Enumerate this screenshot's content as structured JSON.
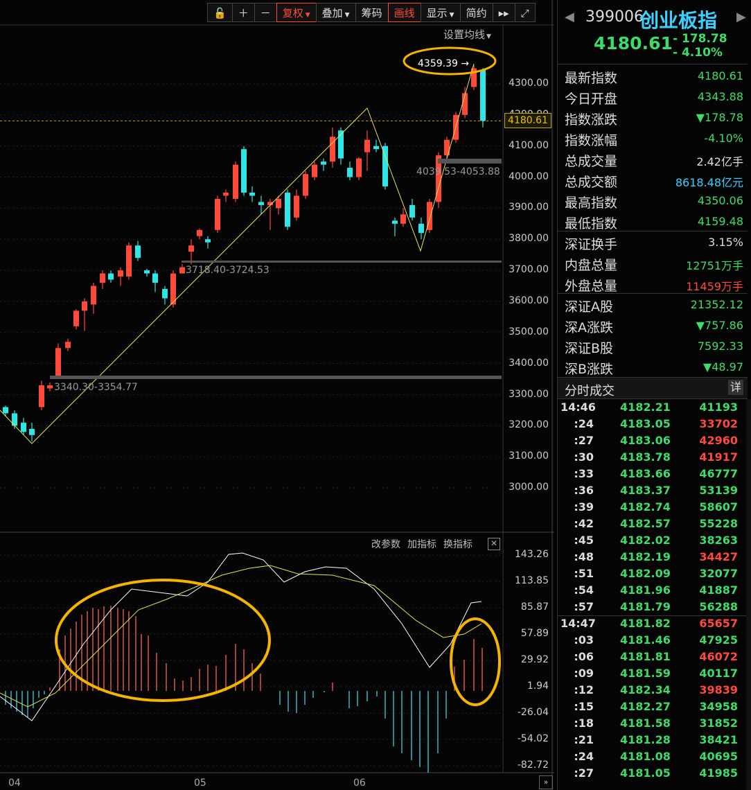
{
  "toolbar": {
    "items": [
      {
        "label": "复权",
        "dropdown": true,
        "color": "red",
        "active": true
      },
      {
        "label": "叠加",
        "dropdown": true
      },
      {
        "label": "筹码",
        "dropdown": false
      },
      {
        "label": "画线",
        "dropdown": false,
        "color": "red",
        "active": true
      },
      {
        "label": "显示",
        "dropdown": true
      },
      {
        "label": "简约",
        "dropdown": false
      }
    ],
    "icons": [
      "lock-icon",
      "plus-icon",
      "minus-icon",
      "double-right-icon",
      "fullscreen-icon"
    ]
  },
  "ma_setting_label": "设置均线",
  "price_axis": [
    "4300.00",
    "4200.00",
    "4100.00",
    "4000.00",
    "3900.00",
    "3800.00",
    "3700.00",
    "3600.00",
    "3500.00",
    "3400.00",
    "3300.00",
    "3200.00",
    "3100.00",
    "3000.00"
  ],
  "current_price_label": "4180.61",
  "annotations": {
    "high": "4359.39",
    "zone1": "3340.30-3354.77",
    "zone2": "3718.40-3724.53",
    "zone3": "4039.53-4053.88"
  },
  "indicator_toolbar": [
    "改参数",
    "加指标",
    "换指标"
  ],
  "indicator_axis": [
    "143.26",
    "113.85",
    "85.87",
    "57.89",
    "29.92",
    "1.94",
    "-26.04",
    "-54.02",
    "-82.72"
  ],
  "x_axis": [
    "04",
    "05",
    "06"
  ],
  "colors": {
    "up": "#ff4a3a",
    "down": "#2ee6e6",
    "highlight": "#f5b400",
    "bg": "#050505"
  },
  "quote": {
    "code": "399006",
    "name": "创业板指",
    "price": "4180.61",
    "change": "- 178.78",
    "change_pct": "- 4.10%"
  },
  "stats": [
    {
      "label": "最新指数",
      "value": "4180.61",
      "color": "green"
    },
    {
      "label": "今日开盘",
      "value": "4343.88",
      "color": "green"
    },
    {
      "label": "指数涨跌",
      "value": "▼178.78",
      "color": "green"
    },
    {
      "label": "指数涨幅",
      "value": "-4.10%",
      "color": "green"
    },
    {
      "label": "总成交量",
      "value": "2.42亿手",
      "color": "white"
    },
    {
      "label": "总成交额",
      "value": "8618.48亿元",
      "color": "blue"
    },
    {
      "label": "最高指数",
      "value": "4350.06",
      "color": "green"
    },
    {
      "label": "最低指数",
      "value": "4159.48",
      "color": "green"
    },
    {
      "label": "深证换手",
      "value": "3.15%",
      "color": "white"
    },
    {
      "label": "内盘总量",
      "value": "12751万手",
      "color": "green"
    },
    {
      "label": "外盘总量",
      "value": "11459万手",
      "color": "red"
    },
    {
      "label": "深证A股",
      "value": "21352.12",
      "color": "green"
    },
    {
      "label": "深A涨跌",
      "value": "▼757.86",
      "color": "green"
    },
    {
      "label": "深证B股",
      "value": "7592.33",
      "color": "green"
    },
    {
      "label": "深B涨跌",
      "value": "▼48.97",
      "color": "green"
    }
  ],
  "ticks_header": {
    "title": "分时成交",
    "detail": "详"
  },
  "ticks": [
    {
      "time": "14:46",
      "price": "4182.21",
      "vol": "41193",
      "dir": "green"
    },
    {
      "time": ":24",
      "price": "4183.05",
      "vol": "33702",
      "dir": "red"
    },
    {
      "time": ":27",
      "price": "4183.06",
      "vol": "42960",
      "dir": "red"
    },
    {
      "time": ":30",
      "price": "4183.78",
      "vol": "41917",
      "dir": "red"
    },
    {
      "time": ":33",
      "price": "4183.66",
      "vol": "46777",
      "dir": "green"
    },
    {
      "time": ":36",
      "price": "4183.37",
      "vol": "53139",
      "dir": "green"
    },
    {
      "time": ":39",
      "price": "4182.74",
      "vol": "58607",
      "dir": "green"
    },
    {
      "time": ":42",
      "price": "4182.57",
      "vol": "55228",
      "dir": "green"
    },
    {
      "time": ":45",
      "price": "4182.02",
      "vol": "38263",
      "dir": "green"
    },
    {
      "time": ":48",
      "price": "4182.19",
      "vol": "34427",
      "dir": "red"
    },
    {
      "time": ":51",
      "price": "4182.09",
      "vol": "32077",
      "dir": "green"
    },
    {
      "time": ":54",
      "price": "4181.96",
      "vol": "41887",
      "dir": "green"
    },
    {
      "time": ":57",
      "price": "4181.79",
      "vol": "56288",
      "dir": "green"
    },
    {
      "time": "14:47",
      "price": "4181.82",
      "vol": "65657",
      "dir": "red"
    },
    {
      "time": ":03",
      "price": "4181.46",
      "vol": "47925",
      "dir": "green"
    },
    {
      "time": ":06",
      "price": "4181.81",
      "vol": "46072",
      "dir": "red"
    },
    {
      "time": ":09",
      "price": "4181.59",
      "vol": "40117",
      "dir": "green"
    },
    {
      "time": ":12",
      "price": "4182.34",
      "vol": "39839",
      "dir": "red"
    },
    {
      "time": ":15",
      "price": "4182.27",
      "vol": "34958",
      "dir": "green"
    },
    {
      "time": ":18",
      "price": "4181.58",
      "vol": "31852",
      "dir": "green"
    },
    {
      "time": ":21",
      "price": "4181.28",
      "vol": "38421",
      "dir": "green"
    },
    {
      "time": ":24",
      "price": "4181.08",
      "vol": "40695",
      "dir": "green"
    },
    {
      "time": ":27",
      "price": "4181.05",
      "vol": "41985",
      "dir": "green"
    }
  ]
}
